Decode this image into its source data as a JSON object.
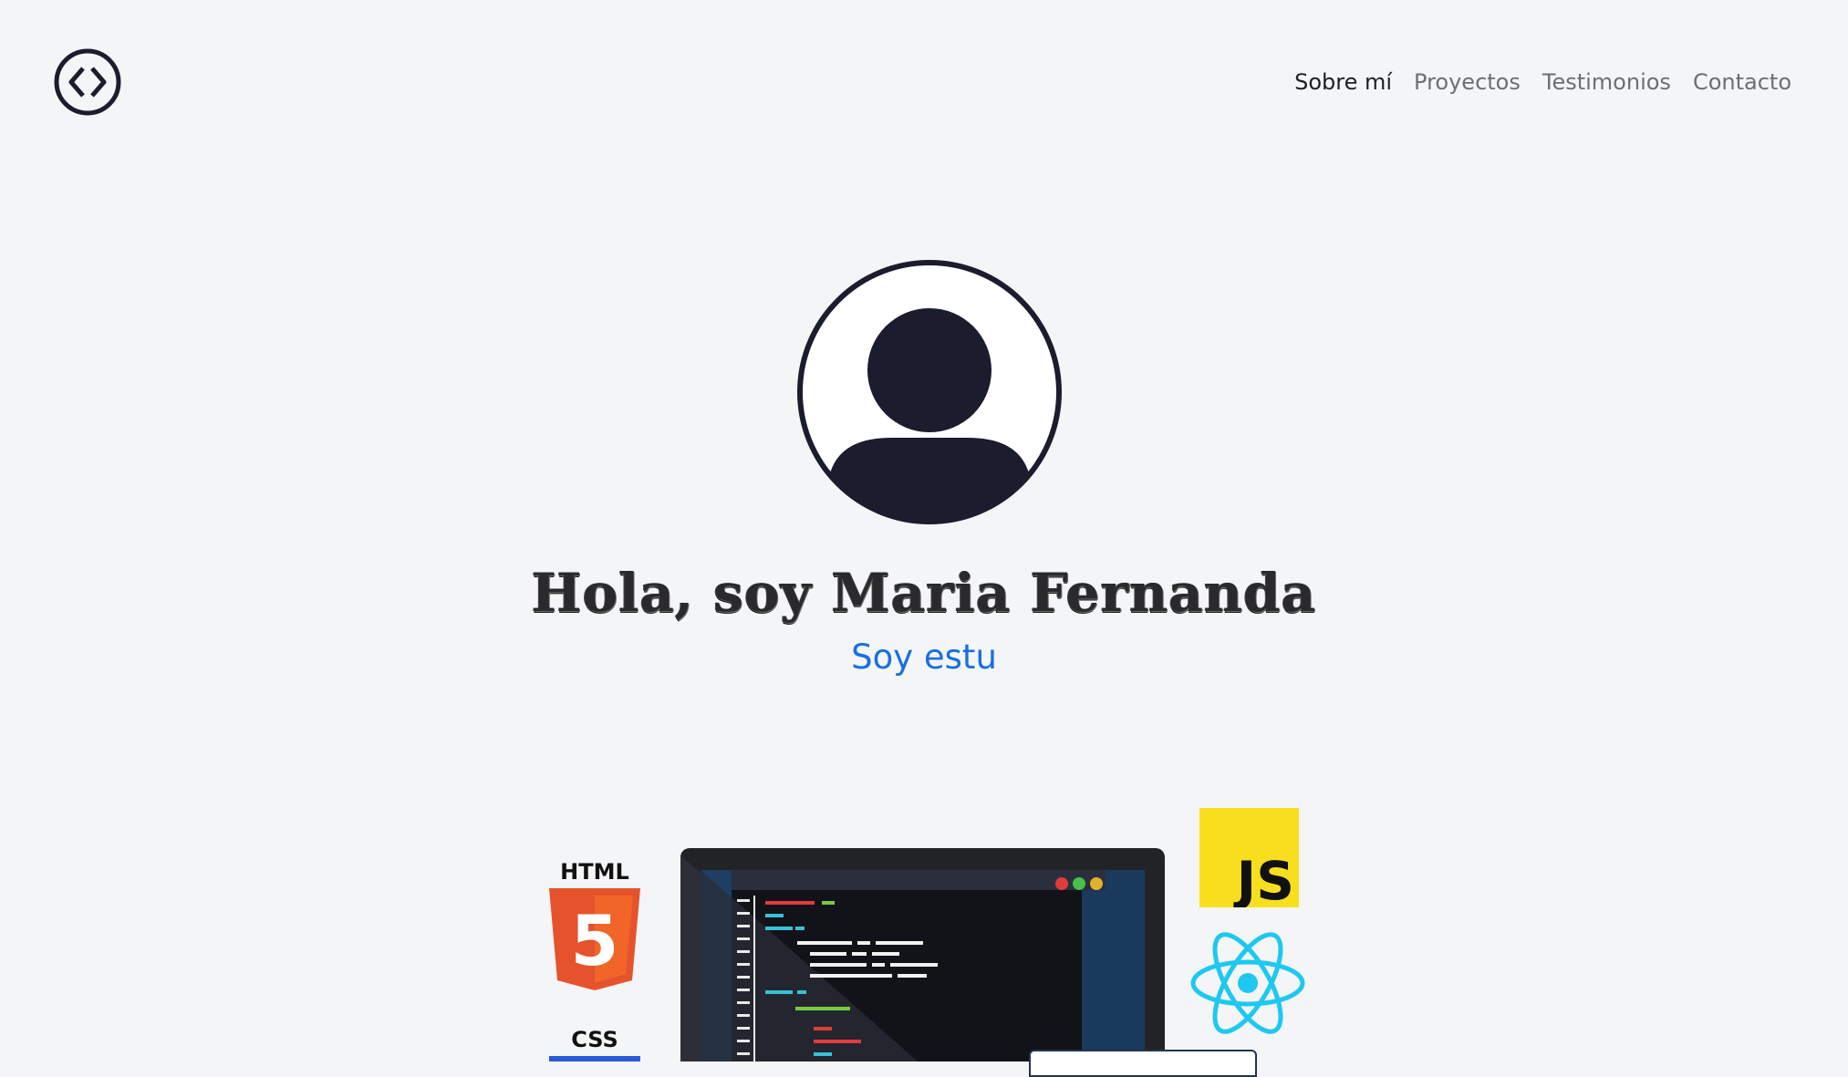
{
  "header": {
    "logo_icon": "code-brackets-icon",
    "nav": [
      {
        "label": "Sobre mí",
        "active": true
      },
      {
        "label": "Proyectos",
        "active": false
      },
      {
        "label": "Testimonios",
        "active": false
      },
      {
        "label": "Contacto",
        "active": false
      }
    ]
  },
  "hero": {
    "avatar_icon": "user-avatar-icon",
    "title": "Hola, soy Maria Fernanda",
    "subtitle": "Soy estu"
  },
  "illustration": {
    "html_label": "HTML",
    "html_digit": "5",
    "css_label": "CSS",
    "js_label": "JS",
    "icons": [
      "html5-icon",
      "css3-icon",
      "laptop-code-icon",
      "javascript-icon",
      "react-icon"
    ]
  },
  "colors": {
    "background": "#f4f5f7",
    "navy": "#1b1d2e",
    "accent_blue": "#1a6fe0",
    "html_orange": "#e5532d",
    "js_yellow": "#f7df1e",
    "react_cyan": "#1ec8f0"
  }
}
